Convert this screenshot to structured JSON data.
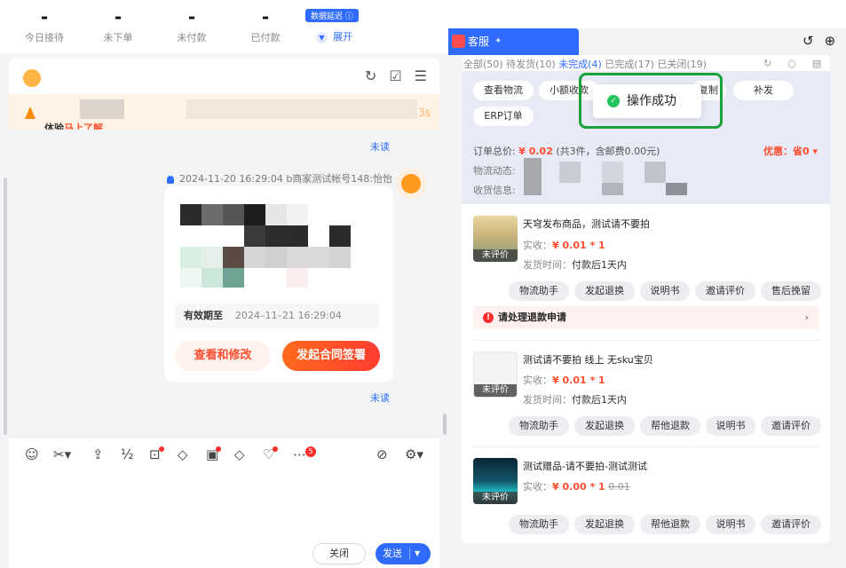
{
  "stats": [
    {
      "value": "-",
      "label": "今日接待"
    },
    {
      "value": "-",
      "label": "未下单"
    },
    {
      "value": "-",
      "label": "未付款"
    },
    {
      "value": "-",
      "label": "已付款"
    }
  ],
  "data_delay_badge": "数据延迟 ⓘ",
  "expand_label": "展开",
  "notice": {
    "text_prefix": "体验",
    "link": "马上了解",
    "timer": "3s"
  },
  "chat": {
    "unread_top": "未读",
    "message_meta": "2024-11-20 16:29:04   b商家测试帐号148:怡怡",
    "validity_label": "有效期至",
    "validity_value": "2024–11–21 16:29:04",
    "view_edit_button": "查看和修改",
    "start_contract_button": "发起合同签署",
    "unread_bottom": "未读"
  },
  "toolbar": {
    "more_badge": "5"
  },
  "composer": {
    "close_button": "关闭",
    "send_button": "发送"
  },
  "right_tab": {
    "title": "客服"
  },
  "order_filters": {
    "all": "全部(50)",
    "to_ship": "待发货(10)",
    "incomplete": "未完成(4)",
    "done": "已完成(17)",
    "closed": "已关闭(19)"
  },
  "order_actions": [
    "查看物流",
    "小额收款",
    "复制",
    "补发",
    "ERP订单"
  ],
  "toast": "操作成功",
  "order_summary": {
    "label": "订单总价:",
    "price": "¥ 0.02",
    "detail": "(共3件，含邮费0.00元)",
    "discount": "优惠：省0 ▾",
    "logistics_label": "物流动态:",
    "address_label": "收货信息:"
  },
  "products": [
    {
      "title": "天穹发布商品，测试请不要拍",
      "paid_label": "实收：",
      "paid_value": "¥ 0.01 * 1",
      "ship_label": "发货时间：",
      "ship_value": "付款后1天内",
      "tag": "未评价",
      "actions": [
        "物流助手",
        "发起退换",
        "说明书",
        "邀请评价",
        "售后挽留"
      ]
    },
    {
      "title": "测试请不要拍 线上 无sku宝贝",
      "paid_label": "实收：",
      "paid_value": "¥ 0.01 * 1",
      "ship_label": "发货时间：",
      "ship_value": "付款后1天内",
      "tag": "未评价",
      "actions": [
        "物流助手",
        "发起退换",
        "帮他退款",
        "说明书",
        "邀请评价"
      ]
    },
    {
      "title": "测试赠品-请不要拍-测试测试",
      "paid_label": "实收：",
      "paid_value": "¥ 0.00 * 1",
      "original_price": "0.01",
      "tag": "未评价",
      "actions": [
        "物流助手",
        "发起退换",
        "帮他退款",
        "说明书",
        "邀请评价"
      ]
    }
  ],
  "refund_notice": "请处理退款申请",
  "colors": {
    "primary": "#2f6bff",
    "accent_red": "#ff4d2f",
    "success": "#20c45b"
  }
}
